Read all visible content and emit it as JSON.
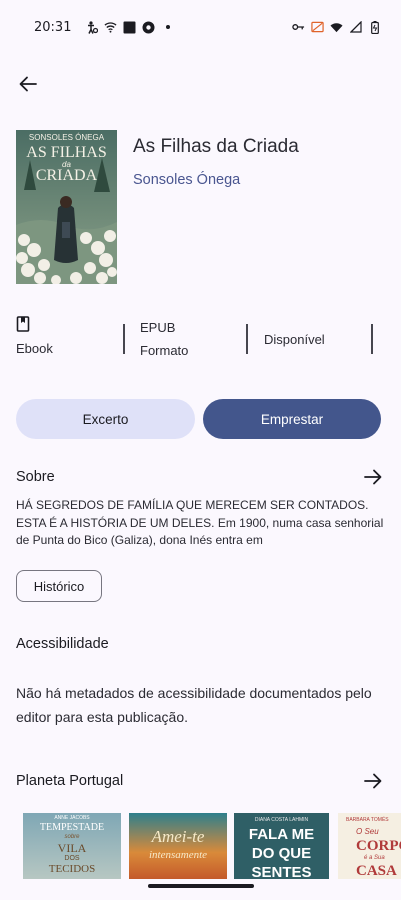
{
  "status_bar": {
    "time": "20:31",
    "left_icons": [
      "accessibility-icon",
      "wifi-calling-icon",
      "app-square-icon",
      "settings-app-icon",
      "dot-icon"
    ],
    "right_icons": [
      "key-icon",
      "no-sim-icon",
      "wifi-icon",
      "signal-icon",
      "battery-icon"
    ]
  },
  "book": {
    "title": "As Filhas da Criada",
    "author": "Sonsoles Ónega",
    "cover": {
      "author": "SONSOLES ÓNEGA",
      "title_line1": "AS FILHAS",
      "title_small": "da",
      "title_line2": "CRIADA"
    }
  },
  "meta": {
    "type_label": "Ebook",
    "format_value": "EPUB",
    "format_label": "Formato",
    "availability": "Disponível"
  },
  "actions": {
    "excerpt": "Excerto",
    "borrow": "Emprestar"
  },
  "about": {
    "heading": "Sobre",
    "text": "HÁ SEGREDOS DE FAMÍLIA QUE MERECEM SER CONTADOS. ESTA É A HISTÓRIA DE UM DELES. Em 1900, numa casa senhorial de Punta do Bico (Galiza), dona Inés entra em",
    "history_button": "Histórico"
  },
  "accessibility": {
    "heading": "Acessibilidade",
    "text": "Não há metadados de acessibilidade documentados pelo editor para esta publicação."
  },
  "publisher": {
    "heading": "Planeta Portugal",
    "books": [
      {
        "line1": "ANNE JACOBS",
        "line2": "TEMPESTADE",
        "line3": "sobre",
        "line4": "VILA",
        "line5": "DOS",
        "line6": "TECIDOS"
      },
      {
        "line1": "Amei-te",
        "line2": "intensamente"
      },
      {
        "line1": "DIANA COSTA LAHMIN",
        "line2": "FALA ME",
        "line3": "DO QUE",
        "line4": "SENTES"
      },
      {
        "line1": "BARBARA TOMÉS",
        "line2": "O Seu",
        "line3": "CORPO",
        "line4": "é a Sua",
        "line5": "CASA"
      }
    ]
  },
  "colors": {
    "background": "#fbf8fe",
    "primary": "#43568c",
    "secondary_container": "#dfe1f8",
    "author_link": "#4a5690"
  }
}
